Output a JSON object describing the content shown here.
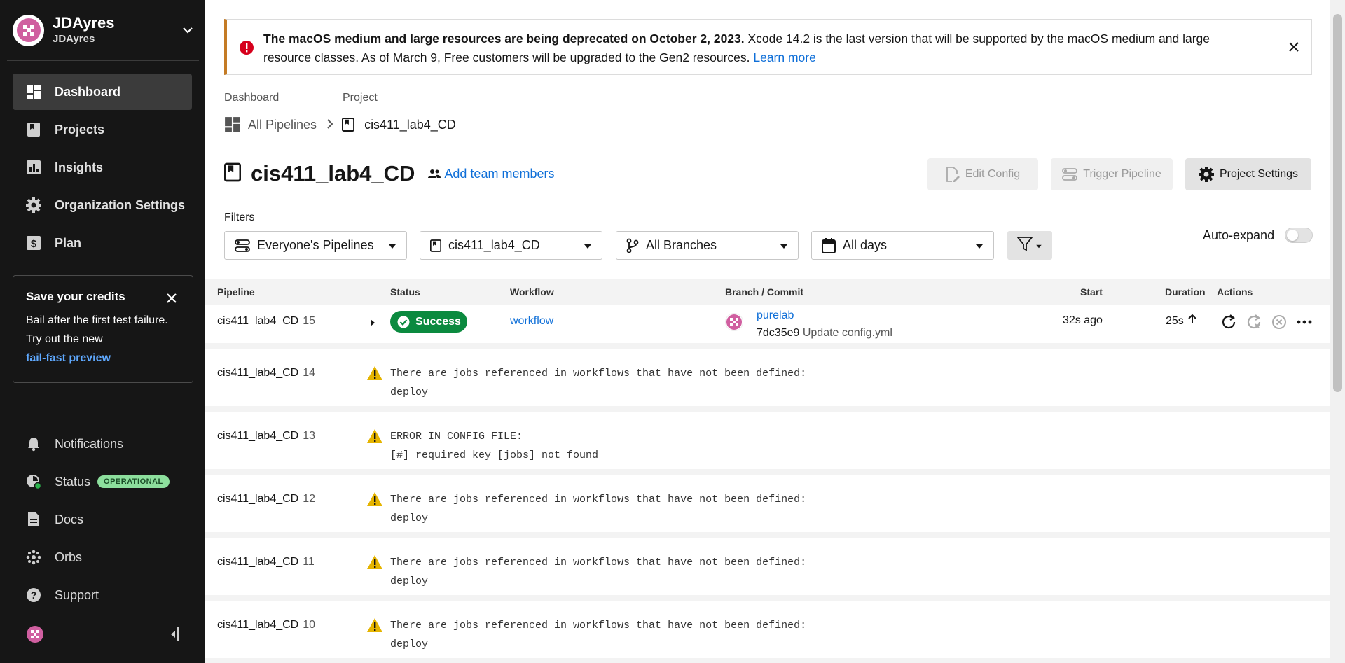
{
  "sidebar": {
    "org_name": "JDAyres",
    "org_sub": "JDAyres",
    "nav": [
      {
        "label": "Dashboard",
        "icon": "dashboard-icon"
      },
      {
        "label": "Projects",
        "icon": "projects-icon"
      },
      {
        "label": "Insights",
        "icon": "insights-icon"
      },
      {
        "label": "Organization Settings",
        "icon": "gear-icon"
      },
      {
        "label": "Plan",
        "icon": "dollar-icon"
      }
    ],
    "credits": {
      "title": "Save your credits",
      "body": "Bail after the first test failure. Try out the new",
      "link": "fail-fast preview"
    },
    "bottom_nav": [
      {
        "label": "Notifications",
        "icon": "bell-icon"
      },
      {
        "label": "Status",
        "icon": "status-icon",
        "badge": "OPERATIONAL"
      },
      {
        "label": "Docs",
        "icon": "docs-icon"
      },
      {
        "label": "Orbs",
        "icon": "orbs-icon"
      },
      {
        "label": "Support",
        "icon": "help-icon"
      }
    ]
  },
  "banner": {
    "bold": "The macOS medium and large resources are being deprecated on October 2, 2023.",
    "text": " Xcode 14.2 is the last version that will be supported by the macOS medium and large resource classes. As of March 9, Free customers will be upgraded to the Gen2 resources. ",
    "link": "Learn more"
  },
  "breadcrumb": {
    "label_dashboard": "Dashboard",
    "label_project": "Project",
    "all_pipelines": "All Pipelines",
    "project": "cis411_lab4_CD"
  },
  "header": {
    "title": "cis411_lab4_CD",
    "add_team": "Add team members",
    "edit_config": "Edit Config",
    "trigger_pipeline": "Trigger Pipeline",
    "project_settings": "Project Settings"
  },
  "filters": {
    "label": "Filters",
    "pipelines": "Everyone's Pipelines",
    "project": "cis411_lab4_CD",
    "branches": "All Branches",
    "days": "All days",
    "auto_expand": "Auto-expand"
  },
  "table": {
    "headers": {
      "pipeline": "Pipeline",
      "status": "Status",
      "workflow": "Workflow",
      "branch_commit": "Branch / Commit",
      "start": "Start",
      "duration": "Duration",
      "actions": "Actions"
    },
    "first_row": {
      "name": "cis411_lab4_CD",
      "number": "15",
      "status": "Success",
      "workflow": "workflow",
      "branch": "purelab",
      "commit_hash": "7dc35e9",
      "commit_msg": "Update config.yml",
      "start": "32s ago",
      "duration": "25s"
    },
    "error_rows": [
      {
        "name": "cis411_lab4_CD",
        "number": "14",
        "line1": "There are jobs referenced in workflows that have not been defined:",
        "line2": "deploy"
      },
      {
        "name": "cis411_lab4_CD",
        "number": "13",
        "line1": "ERROR IN CONFIG FILE:",
        "line2": "[#] required key [jobs] not found"
      },
      {
        "name": "cis411_lab4_CD",
        "number": "12",
        "line1": "There are jobs referenced in workflows that have not been defined:",
        "line2": "deploy"
      },
      {
        "name": "cis411_lab4_CD",
        "number": "11",
        "line1": "There are jobs referenced in workflows that have not been defined:",
        "line2": "deploy"
      },
      {
        "name": "cis411_lab4_CD",
        "number": "10",
        "line1": "There are jobs referenced in workflows that have not been defined:",
        "line2": "deploy"
      }
    ]
  },
  "colors": {
    "sidebar_bg": "#161616",
    "link": "#0f6fd8",
    "success": "#0b8a3f",
    "warning": "#e5b400",
    "banner_accent": "#c47b25",
    "error_red": "#d6001c"
  }
}
